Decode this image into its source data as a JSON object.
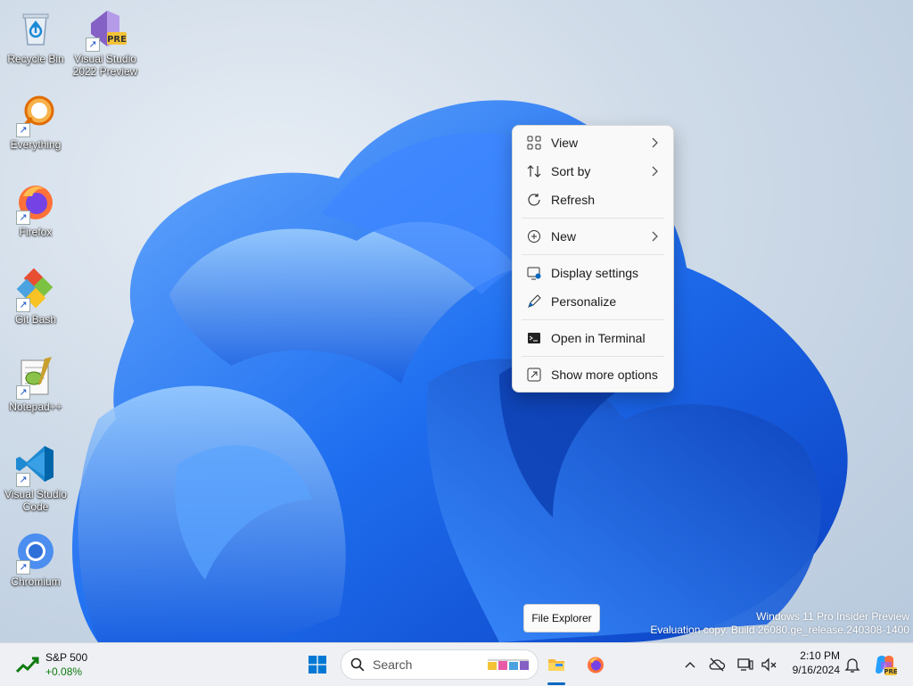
{
  "desktop": {
    "icons": [
      {
        "label_lines": [
          "Recycle Bin"
        ],
        "icon": "recycle-bin-icon"
      },
      {
        "label_lines": [
          "Visual Studio",
          "2022 Preview"
        ],
        "icon": "visual-studio-preview-icon",
        "badge": "PRE"
      },
      {
        "label_lines": [
          "Everything"
        ],
        "icon": "everything-search-icon"
      },
      {
        "label_lines": [
          "Firefox"
        ],
        "icon": "firefox-icon"
      },
      {
        "label_lines": [
          "Git Bash"
        ],
        "icon": "git-bash-icon"
      },
      {
        "label_lines": [
          "Notepad++"
        ],
        "icon": "notepad-plus-plus-icon"
      },
      {
        "label_lines": [
          "Visual Studio",
          "Code"
        ],
        "icon": "vscode-icon"
      },
      {
        "label_lines": [
          "Chromium"
        ],
        "icon": "chromium-icon"
      }
    ]
  },
  "context_menu": {
    "items": [
      {
        "label": "View",
        "icon": "grid-view-icon",
        "submenu": true
      },
      {
        "label": "Sort by",
        "icon": "sort-icon",
        "submenu": true
      },
      {
        "label": "Refresh",
        "icon": "refresh-icon",
        "submenu": false
      },
      {
        "label": "New",
        "icon": "plus-circle-icon",
        "submenu": true
      },
      {
        "label": "Display settings",
        "icon": "display-settings-icon",
        "submenu": false
      },
      {
        "label": "Personalize",
        "icon": "pen-icon",
        "submenu": false
      },
      {
        "label": "Open in Terminal",
        "icon": "terminal-icon",
        "submenu": false
      },
      {
        "label": "Show more options",
        "icon": "show-more-icon",
        "submenu": false
      }
    ]
  },
  "tooltip": {
    "text": "File Explorer"
  },
  "watermark": {
    "line1": "Windows 11 Pro Insider Preview",
    "line2": "Evaluation copy. Build 26080.ge_release.240308-1400"
  },
  "taskbar": {
    "widget": {
      "name": "S&P 500",
      "change": "+0.08%"
    },
    "search": {
      "placeholder": "Search"
    },
    "clock": {
      "time": "2:10 PM",
      "date": "9/16/2024"
    }
  },
  "colors": {
    "accent": "#0067c0",
    "wallpaper_blue": "#1a5fe0",
    "positive": "#0f7b0f"
  }
}
